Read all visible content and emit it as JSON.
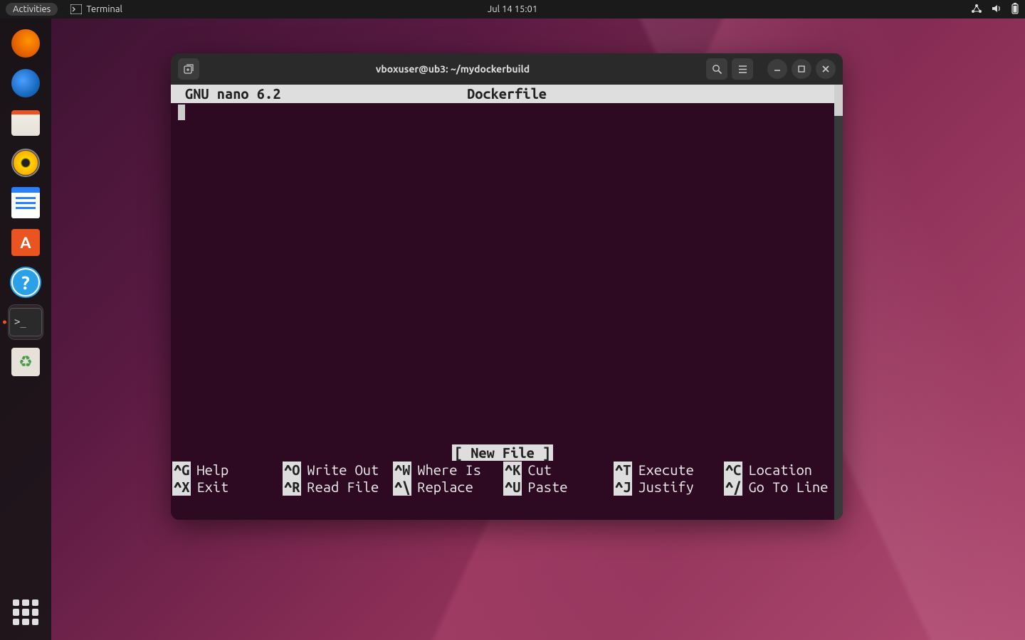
{
  "topbar": {
    "activities": "Activities",
    "app_label": "Terminal",
    "clock": "Jul 14  15:01"
  },
  "terminal": {
    "title": "vboxuser@ub3: ~/mydockerbuild",
    "nano": {
      "editor_name": "GNU nano 6.2",
      "filename": "Dockerfile",
      "status": "[ New File ]",
      "shortcuts": [
        {
          "k": "^G",
          "l": "Help"
        },
        {
          "k": "^O",
          "l": "Write Out"
        },
        {
          "k": "^W",
          "l": "Where Is"
        },
        {
          "k": "^K",
          "l": "Cut"
        },
        {
          "k": "^T",
          "l": "Execute"
        },
        {
          "k": "^C",
          "l": "Location"
        },
        {
          "k": "^X",
          "l": "Exit"
        },
        {
          "k": "^R",
          "l": "Read File"
        },
        {
          "k": "^\\",
          "l": "Replace"
        },
        {
          "k": "^U",
          "l": "Paste"
        },
        {
          "k": "^J",
          "l": "Justify"
        },
        {
          "k": "^/",
          "l": "Go To Line"
        }
      ]
    }
  },
  "icons": {
    "software_letter": "A",
    "help_glyph": "?",
    "term_prompt": ">_",
    "trash_glyph": "♻"
  }
}
